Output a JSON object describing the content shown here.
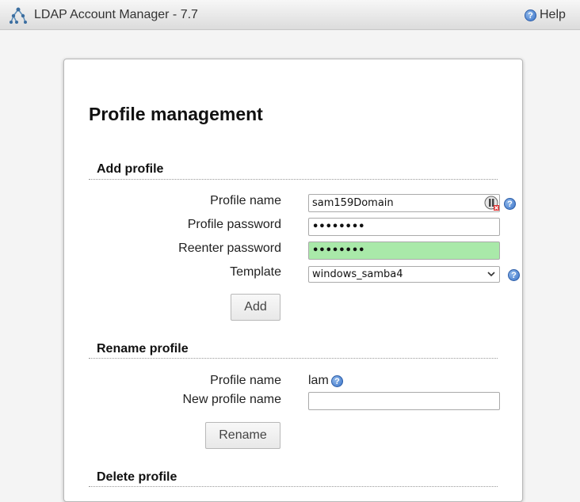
{
  "app": {
    "title": "LDAP Account Manager - 7.7",
    "help_label": "Help"
  },
  "page": {
    "title": "Profile management"
  },
  "add_profile": {
    "section_title": "Add profile",
    "profile_name_label": "Profile name",
    "profile_name_value": "sam159Domain",
    "profile_password_label": "Profile password",
    "profile_password_value": "••••••••",
    "reenter_password_label": "Reenter password",
    "reenter_password_value": "••••••••",
    "template_label": "Template",
    "template_value": "windows_samba4",
    "add_button": "Add"
  },
  "rename_profile": {
    "section_title": "Rename profile",
    "profile_name_label": "Profile name",
    "profile_name_value": "lam",
    "new_profile_name_label": "New profile name",
    "new_profile_name_value": "",
    "rename_button": "Rename"
  },
  "delete_profile": {
    "section_title": "Delete profile"
  },
  "colors": {
    "match_field": "#a9e9a9",
    "help_icon": "#3a73c8"
  },
  "icons": {
    "logo": "ldap-tree-icon",
    "help": "question-circle-icon",
    "password_manager": "password-key-icon"
  }
}
